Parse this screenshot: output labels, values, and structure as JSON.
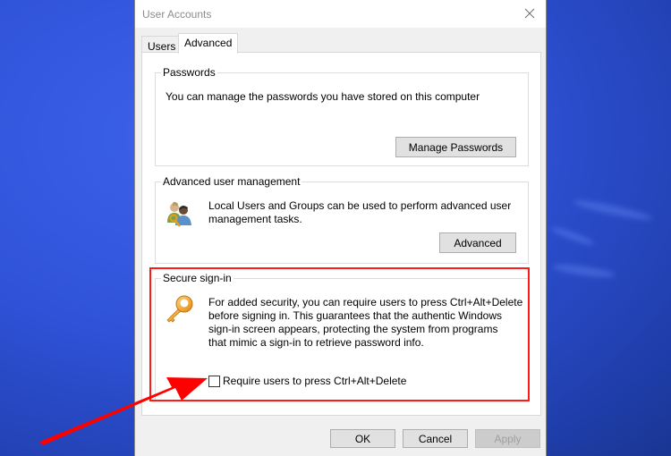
{
  "window": {
    "title": "User Accounts",
    "close_icon": "close-icon"
  },
  "tabs": [
    {
      "label": "Users",
      "active": false
    },
    {
      "label": "Advanced",
      "active": true
    }
  ],
  "passwords": {
    "title": "Passwords",
    "description": "You can manage the passwords you have stored on this computer",
    "button": "Manage Passwords"
  },
  "advanced_user_management": {
    "title": "Advanced user management",
    "icon": "users-key-icon",
    "description_line1": "Local Users and Groups can be used to perform advanced user",
    "description_line2": "management tasks.",
    "button": "Advanced"
  },
  "secure_signin": {
    "title": "Secure sign-in",
    "icon": "key-icon",
    "description_lines": [
      "For added security, you can require users to press Ctrl+Alt+Delete",
      "before signing in. This guarantees that the authentic Windows",
      "sign-in screen appears, protecting the system from programs",
      "that mimic a sign-in to retrieve password info."
    ],
    "checkbox_label": "Require users to press Ctrl+Alt+Delete",
    "checkbox_checked": false
  },
  "footer": {
    "ok": "OK",
    "cancel": "Cancel",
    "apply": "Apply",
    "apply_enabled": false
  },
  "annotation": {
    "highlight_color": "#ff1a1a",
    "arrow_color": "#ff0000"
  }
}
